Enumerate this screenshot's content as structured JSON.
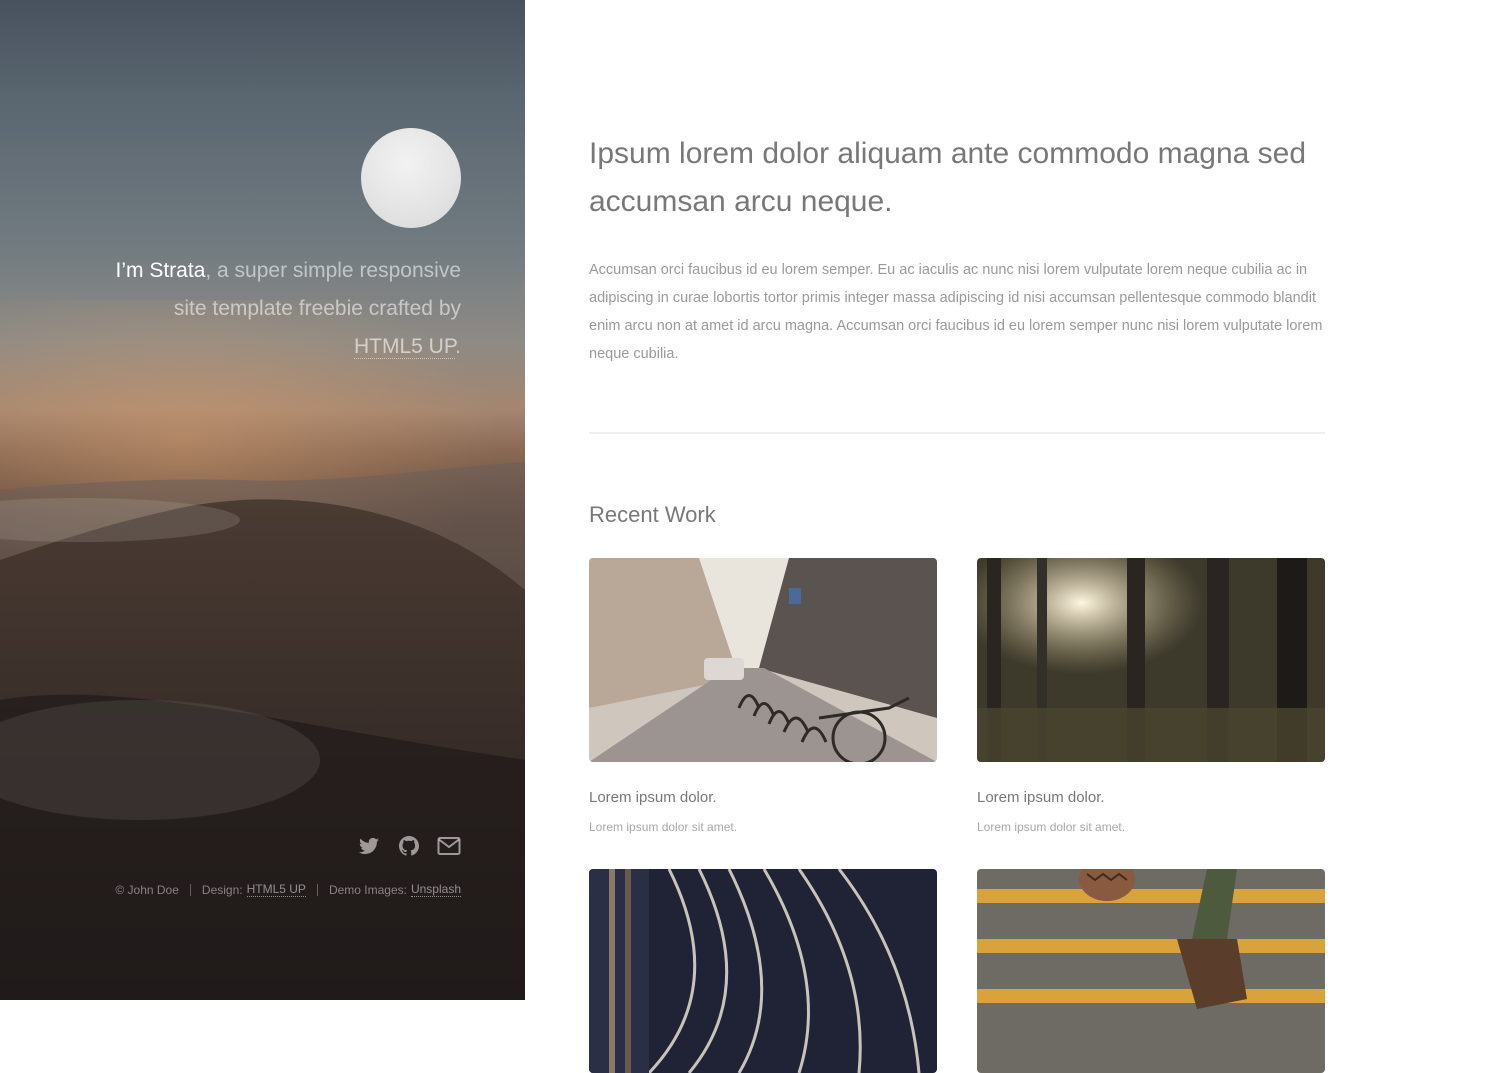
{
  "sidebar": {
    "intro": {
      "name": "I’m Strata",
      "text_after_name": ", a super simple responsive site template freebie crafted by ",
      "link": "HTML5 UP",
      "end": "."
    },
    "social_icons": [
      "twitter-icon",
      "github-icon",
      "envelope-icon"
    ],
    "copyright": {
      "owner": "© John Doe",
      "design_label": "Design:",
      "design_link": "HTML5 UP",
      "images_label": "Demo Images:",
      "images_link": "Unsplash"
    }
  },
  "main": {
    "headline": "Ipsum lorem dolor aliquam ante commodo magna sed accumsan arcu neque.",
    "body": "Accumsan orci faucibus id eu lorem semper. Eu ac iaculis ac nunc nisi lorem vulputate lorem neque cubilia ac in adipiscing in curae lobortis tortor primis integer massa adipiscing id nisi accumsan pellentesque commodo blandit enim arcu non at amet id arcu magna. Accumsan orci faucibus id eu lorem semper nunc nisi lorem vulputate lorem neque cubilia.",
    "section_title": "Recent Work",
    "works": [
      {
        "title": "Lorem ipsum dolor.",
        "description": "Lorem ipsum dolor sit amet."
      },
      {
        "title": "Lorem ipsum dolor.",
        "description": "Lorem ipsum dolor sit amet."
      },
      {
        "title": "",
        "description": ""
      },
      {
        "title": "",
        "description": ""
      }
    ]
  },
  "colors": {
    "text_dark": "#787878",
    "text_light": "#9a9a9a",
    "sidebar_sky": "#5a6670",
    "sidebar_ground": "#2e2624"
  }
}
